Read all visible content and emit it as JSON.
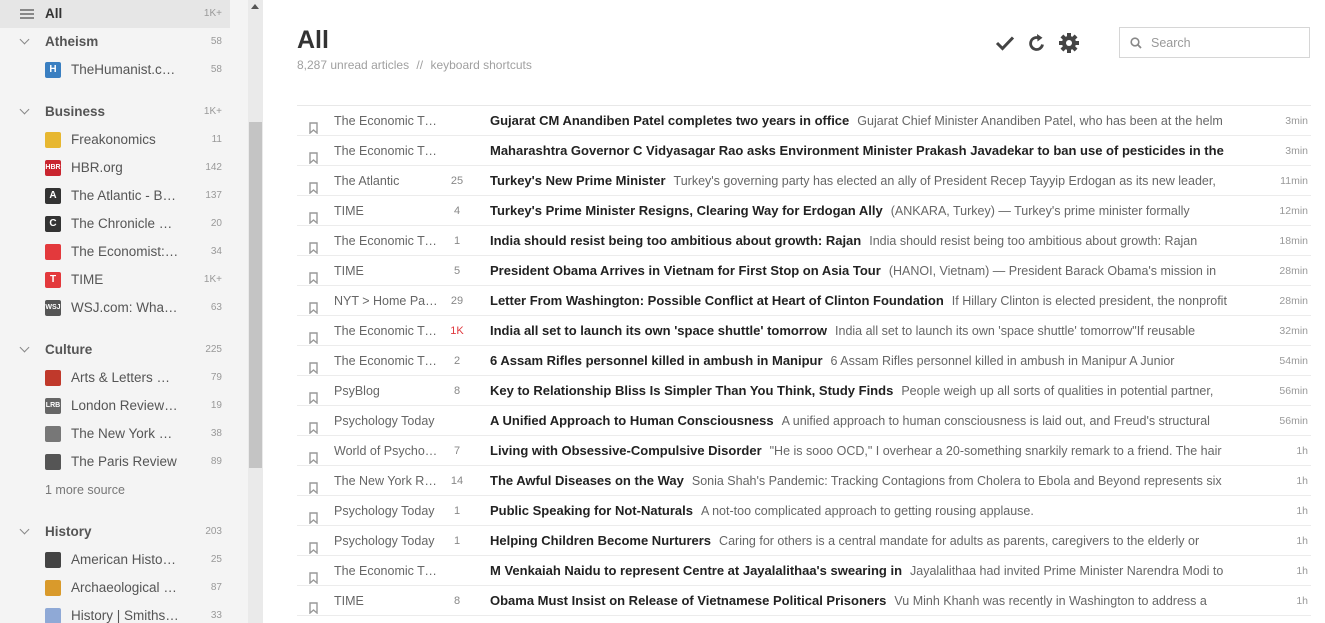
{
  "sidebar": {
    "all": {
      "label": "All",
      "count": "1K+"
    },
    "groups": [
      {
        "label": "Atheism",
        "count": "58",
        "feeds": [
          {
            "label": "TheHumanist.com",
            "count": "58",
            "icon": "humanist-icon",
            "icon_text": "H",
            "color": "#3a7fc1"
          }
        ]
      },
      {
        "label": "Business",
        "count": "1K+",
        "feeds": [
          {
            "label": "Freakonomics",
            "count": "11",
            "icon": "freakonomics-icon",
            "icon_text": "",
            "color": "#e7b730"
          },
          {
            "label": "HBR.org",
            "count": "142",
            "icon": "hbr-icon",
            "icon_text": "HBR",
            "color": "#c9252f"
          },
          {
            "label": "The Atlantic - Business",
            "count": "137",
            "icon": "atlantic-icon",
            "icon_text": "A",
            "color": "#333333"
          },
          {
            "label": "The Chronicle of Higher Education",
            "count": "20",
            "icon": "chronicle-icon",
            "icon_text": "C",
            "color": "#333333"
          },
          {
            "label": "The Economist: Business",
            "count": "34",
            "icon": "economist-icon",
            "icon_text": "",
            "color": "#e3393c"
          },
          {
            "label": "TIME",
            "count": "1K+",
            "icon": "time-icon",
            "icon_text": "T",
            "color": "#e3393c"
          },
          {
            "label": "WSJ.com: What's News",
            "count": "63",
            "icon": "wsj-icon",
            "icon_text": "WSJ",
            "color": "#555555"
          }
        ]
      },
      {
        "label": "Culture",
        "count": "225",
        "feeds": [
          {
            "label": "Arts & Letters Daily",
            "count": "79",
            "icon": "arts-letters-icon",
            "icon_text": "",
            "color": "#c0392b"
          },
          {
            "label": "London Review of Books",
            "count": "19",
            "icon": "lrb-icon",
            "icon_text": "LRB",
            "color": "#666666"
          },
          {
            "label": "The New York Review of Books",
            "count": "38",
            "icon": "nyrb-icon",
            "icon_text": "",
            "color": "#777777"
          },
          {
            "label": "The Paris Review",
            "count": "89",
            "icon": "paris-review-icon",
            "icon_text": "",
            "color": "#555555"
          }
        ],
        "more": "1 more source"
      },
      {
        "label": "History",
        "count": "203",
        "feeds": [
          {
            "label": "American Historical Association",
            "count": "25",
            "icon": "aha-icon",
            "icon_text": "",
            "color": "#444444"
          },
          {
            "label": "Archaeological Headlines",
            "count": "87",
            "icon": "archaeology-icon",
            "icon_text": "",
            "color": "#d99a2b"
          },
          {
            "label": "History | Smithsonian",
            "count": "33",
            "icon": "rss-icon",
            "icon_text": "",
            "color": "#8fa9d6"
          }
        ]
      }
    ]
  },
  "header": {
    "title": "All",
    "unread": "8,287 unread articles",
    "separator": "//",
    "shortcuts": "keyboard shortcuts"
  },
  "search": {
    "placeholder": "Search"
  },
  "articles": [
    {
      "source": "The Economic Times",
      "count": "",
      "title": "Gujarat CM Anandiben Patel completes two years in office",
      "snippet": "Gujarat Chief Minister Anandiben Patel, who has been at the helm",
      "age": "3min"
    },
    {
      "source": "The Economic Times",
      "count": "",
      "title": "Maharashtra Governor C Vidyasagar Rao asks Environment Minister Prakash Javadekar to ban use of pesticides in the",
      "snippet": "",
      "age": "3min"
    },
    {
      "source": "The Atlantic",
      "count": "25",
      "title": "Turkey's New Prime Minister",
      "snippet": "Turkey's governing party has elected an ally of President Recep Tayyip Erdogan as its new leader,",
      "age": "11min"
    },
    {
      "source": "TIME",
      "count": "4",
      "title": "Turkey's Prime Minister Resigns, Clearing Way for Erdogan Ally",
      "snippet": "(ANKARA, Turkey) — Turkey's prime minister formally",
      "age": "12min"
    },
    {
      "source": "The Economic Times",
      "count": "1",
      "title": "India should resist being too ambitious about growth: Rajan",
      "snippet": "India should resist being too ambitious about growth: Rajan",
      "age": "18min"
    },
    {
      "source": "TIME",
      "count": "5",
      "title": "President Obama Arrives in Vietnam for First Stop on Asia Tour",
      "snippet": "(HANOI, Vietnam) — President Barack Obama's mission in",
      "age": "28min"
    },
    {
      "source": "NYT > Home Page",
      "count": "29",
      "title": "Letter From Washington: Possible Conflict at Heart of Clinton Foundation",
      "snippet": "If Hillary Clinton is elected president, the nonprofit",
      "age": "28min"
    },
    {
      "source": "The Economic Times",
      "count": "1K",
      "hot": true,
      "title": "India all set to launch its own 'space shuttle' tomorrow",
      "snippet": "India all set to launch its own 'space shuttle' tomorrow\"If reusable",
      "age": "32min"
    },
    {
      "source": "The Economic Times",
      "count": "2",
      "title": "6 Assam Rifles personnel killed in ambush in Manipur",
      "snippet": "6 Assam Rifles personnel killed in ambush in Manipur A Junior",
      "age": "54min"
    },
    {
      "source": "PsyBlog",
      "count": "8",
      "title": "Key to Relationship Bliss Is Simpler Than You Think, Study Finds",
      "snippet": "People weigh up all sorts of qualities in potential partner,",
      "age": "56min"
    },
    {
      "source": "Psychology Today",
      "count": "",
      "title": "A Unified Approach to Human Consciousness",
      "snippet": "A unified approach to human consciousness is laid out, and Freud's structural",
      "age": "56min"
    },
    {
      "source": "World of Psychology",
      "count": "7",
      "title": "Living with Obsessive-Compulsive Disorder",
      "snippet": "\"He is sooo OCD,\" I overhear a 20-something snarkily remark to a friend. The hair",
      "age": "1h"
    },
    {
      "source": "The New York Review of Books",
      "count": "14",
      "title": "The Awful Diseases on the Way",
      "snippet": "Sonia Shah's Pandemic: Tracking Contagions from Cholera to Ebola and Beyond represents six",
      "age": "1h"
    },
    {
      "source": "Psychology Today",
      "count": "1",
      "title": "Public Speaking for Not-Naturals",
      "snippet": "A not-too complicated approach to getting rousing applause.",
      "age": "1h"
    },
    {
      "source": "Psychology Today",
      "count": "1",
      "title": "Helping Children Become Nurturers",
      "snippet": "Caring for others is a central mandate for adults as parents, caregivers to the elderly or",
      "age": "1h"
    },
    {
      "source": "The Economic Times",
      "count": "",
      "title": "M Venkaiah Naidu to represent Centre at Jayalalithaa's swearing in",
      "snippet": "Jayalalithaa had invited Prime Minister Narendra Modi to",
      "age": "1h"
    },
    {
      "source": "TIME",
      "count": "8",
      "title": "Obama Must Insist on Release of Vietnamese Political Prisoners",
      "snippet": "Vu Minh Khanh was recently in Washington to address a",
      "age": "1h"
    }
  ]
}
